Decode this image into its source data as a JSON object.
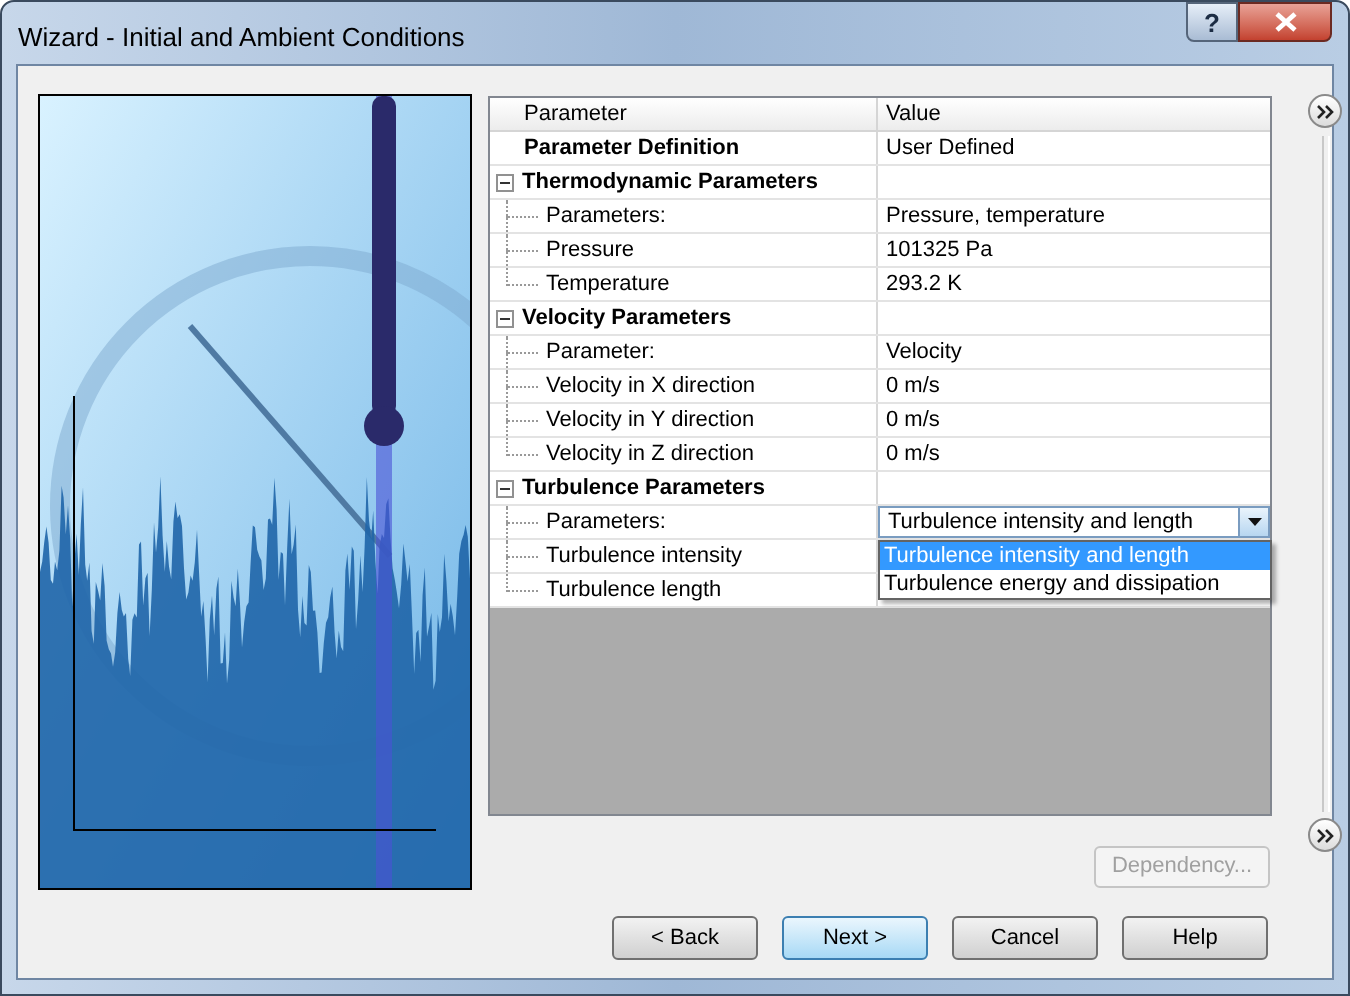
{
  "window": {
    "title": "Wizard - Initial and Ambient Conditions",
    "help_button": "?"
  },
  "grid": {
    "columns": [
      "Parameter",
      "Value"
    ],
    "rows": [
      {
        "kind": "property",
        "label": "Parameter Definition",
        "value": "User Defined",
        "bold": true
      },
      {
        "kind": "group",
        "label": "Thermodynamic Parameters",
        "expanded": true,
        "children": [
          {
            "kind": "property",
            "label": "Parameters:",
            "value": "Pressure, temperature"
          },
          {
            "kind": "property",
            "label": "Pressure",
            "value": "101325 Pa"
          },
          {
            "kind": "property",
            "label": "Temperature",
            "value": "293.2 K"
          }
        ]
      },
      {
        "kind": "group",
        "label": "Velocity Parameters",
        "expanded": true,
        "children": [
          {
            "kind": "property",
            "label": "Parameter:",
            "value": "Velocity"
          },
          {
            "kind": "property",
            "label": "Velocity in X direction",
            "value": "0 m/s"
          },
          {
            "kind": "property",
            "label": "Velocity in Y direction",
            "value": "0 m/s"
          },
          {
            "kind": "property",
            "label": "Velocity in Z direction",
            "value": "0 m/s"
          }
        ]
      },
      {
        "kind": "group",
        "label": "Turbulence Parameters",
        "expanded": true,
        "children": [
          {
            "kind": "dropdown",
            "label": "Parameters:",
            "value": "Turbulence intensity and length",
            "open": true,
            "options": [
              {
                "label": "Turbulence intensity and length",
                "selected": true
              },
              {
                "label": "Turbulence energy and dissipation",
                "selected": false
              }
            ]
          },
          {
            "kind": "property",
            "label": "Turbulence intensity"
          },
          {
            "kind": "property",
            "label": "Turbulence length"
          }
        ]
      }
    ]
  },
  "dependency_button": {
    "label": "Dependency...",
    "disabled": true
  },
  "buttons": [
    {
      "label": "< Back",
      "focused": false
    },
    {
      "label": "Next >",
      "focused": true
    },
    {
      "label": "Cancel",
      "focused": false
    },
    {
      "label": "Help",
      "focused": false
    }
  ]
}
